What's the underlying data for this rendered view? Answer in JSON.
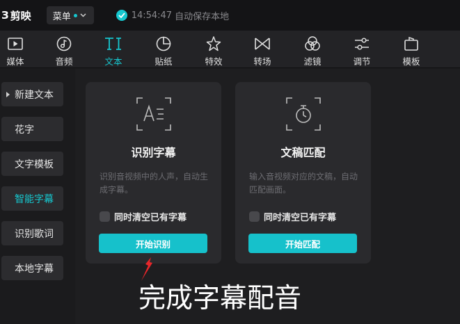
{
  "app": {
    "logo_mark": "З",
    "name": "剪映",
    "menu_label": "菜单",
    "save_time": "14:54:47",
    "save_text": "自动保存本地",
    "accent_color": "#16c7cf"
  },
  "toolbar": {
    "items": [
      {
        "label": "媒体",
        "icon": "media-play-icon"
      },
      {
        "label": "音频",
        "icon": "audio-note-icon"
      },
      {
        "label": "文本",
        "icon": "text-ti-icon",
        "active": true
      },
      {
        "label": "贴纸",
        "icon": "sticker-icon"
      },
      {
        "label": "特效",
        "icon": "effects-star-icon"
      },
      {
        "label": "转场",
        "icon": "transition-bowtie-icon"
      },
      {
        "label": "滤镜",
        "icon": "filter-circles-icon"
      },
      {
        "label": "调节",
        "icon": "adjust-sliders-icon"
      },
      {
        "label": "模板",
        "icon": "template-icon"
      }
    ]
  },
  "sidebar": {
    "items": [
      {
        "label": "新建文本",
        "has_arrow": true
      },
      {
        "label": "花字"
      },
      {
        "label": "文字模板"
      },
      {
        "label": "智能字幕",
        "active": true
      },
      {
        "label": "识别歌词"
      },
      {
        "label": "本地字幕"
      }
    ]
  },
  "cards": [
    {
      "icon": "speech-text-recognition-icon",
      "title": "识别字幕",
      "desc": "识别音视频中的人声，自动生成字幕。",
      "checkbox_label": "同时清空已有字幕",
      "button_label": "开始识别"
    },
    {
      "icon": "timer-script-icon",
      "title": "文稿匹配",
      "desc": "输入音视频对应的文稿，自动匹配画面。",
      "checkbox_label": "同时清空已有字幕",
      "button_label": "开始匹配"
    }
  ],
  "annotation": {
    "text": "完成字幕配音",
    "arrow_color": "#e8262a"
  }
}
